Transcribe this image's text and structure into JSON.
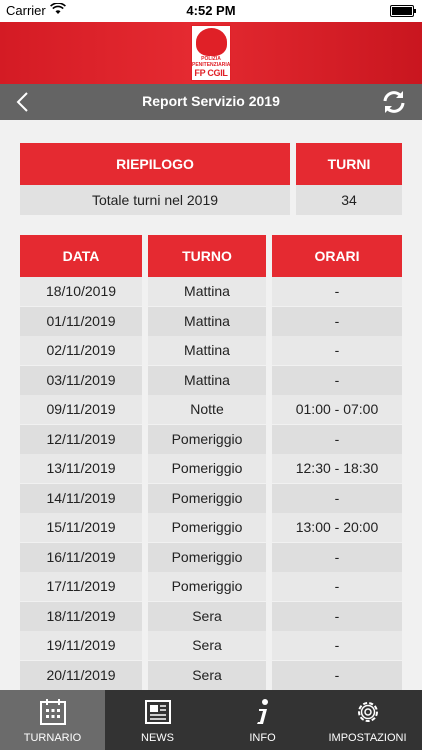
{
  "status_bar": {
    "carrier": "Carrier",
    "time": "4:52 PM"
  },
  "brand": {
    "logo_line1": "POLIZIA PENITENZIARIA",
    "logo_line2": "FP CGIL"
  },
  "navbar": {
    "title": "Report Servizio 2019"
  },
  "summary": {
    "header_left": "RIEPILOGO",
    "header_right": "TURNI",
    "label": "Totale turni nel 2019",
    "value": "34"
  },
  "table": {
    "headers": [
      "DATA",
      "TURNO",
      "ORARI"
    ],
    "rows": [
      [
        "18/10/2019",
        "Mattina",
        "-"
      ],
      [
        "01/11/2019",
        "Mattina",
        "-"
      ],
      [
        "02/11/2019",
        "Mattina",
        "-"
      ],
      [
        "03/11/2019",
        "Mattina",
        "-"
      ],
      [
        "09/11/2019",
        "Notte",
        "01:00 - 07:00"
      ],
      [
        "12/11/2019",
        "Pomeriggio",
        "-"
      ],
      [
        "13/11/2019",
        "Pomeriggio",
        "12:30 - 18:30"
      ],
      [
        "14/11/2019",
        "Pomeriggio",
        "-"
      ],
      [
        "15/11/2019",
        "Pomeriggio",
        "13:00 - 20:00"
      ],
      [
        "16/11/2019",
        "Pomeriggio",
        "-"
      ],
      [
        "17/11/2019",
        "Pomeriggio",
        "-"
      ],
      [
        "18/11/2019",
        "Sera",
        "-"
      ],
      [
        "19/11/2019",
        "Sera",
        "-"
      ],
      [
        "20/11/2019",
        "Sera",
        "-"
      ]
    ]
  },
  "tabs": [
    {
      "label": "TURNARIO",
      "icon": "calendar-icon",
      "active": true
    },
    {
      "label": "NEWS",
      "icon": "newspaper-icon",
      "active": false
    },
    {
      "label": "INFO",
      "icon": "info-icon",
      "active": false
    },
    {
      "label": "IMPOSTAZIONI",
      "icon": "gear-icon",
      "active": false
    }
  ],
  "colors": {
    "accent": "#e52a31",
    "navbar": "#646464",
    "tabbar": "#333333"
  }
}
